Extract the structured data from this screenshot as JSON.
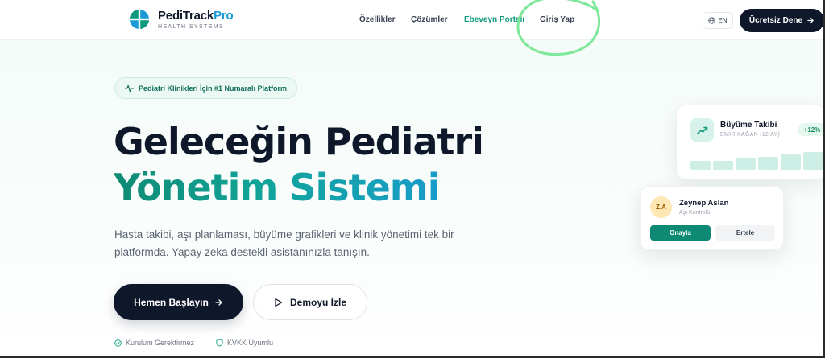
{
  "brand": {
    "name_main": "PediTrack",
    "name_accent": "Pro",
    "tagline": "HEALTH SYSTEMS"
  },
  "nav": {
    "features": "Özellikler",
    "solutions": "Çözümler",
    "parent_portal": "Ebeveyn Portalı",
    "login": "Giriş Yap",
    "language": "EN",
    "cta": "Ücretsiz Dene"
  },
  "hero": {
    "badge": "Pediatri Klinikleri İçin #1 Numaralı Platform",
    "headline_line1": "Geleceğin Pediatri",
    "headline_line2": "Yönetim Sistemi",
    "description": "Hasta takibi, aşı planlaması, büyüme grafikleri ve klinik yönetimi tek bir platformda. Yapay zeka destekli asistanınızla tanışın.",
    "primary_button": "Hemen Başlayın",
    "secondary_button": "Demoyu İzle",
    "trust_1": "Kurulum Gerektirmez",
    "trust_2": "KVKK Uyumlu"
  },
  "growth_card": {
    "title": "Büyüme Takibi",
    "subtitle": "EMİR KAĞAN (12 AY)",
    "change": "+12%",
    "bar_levels": [
      0.42,
      0.42,
      0.55,
      0.6,
      0.7,
      0.82,
      0.82
    ]
  },
  "vaccine_card": {
    "initials": "Z.A",
    "name": "Zeynep Aslan",
    "subtitle": "Aşı Kontrolü",
    "approve": "Onayla",
    "postpone": "Ertele"
  },
  "colors": {
    "primary_dark": "#0f172a",
    "accent_green": "#0f9a7e",
    "accent_blue": "#1a9bd7",
    "annotation": "#7ee89a"
  },
  "icons": {
    "logo": "logo-mark-icon",
    "globe": "globe-icon",
    "arrow": "arrow-right-icon",
    "activity": "activity-icon",
    "play": "play-icon",
    "check": "check-circle-icon",
    "shield": "shield-icon",
    "trend": "trending-up-icon"
  }
}
